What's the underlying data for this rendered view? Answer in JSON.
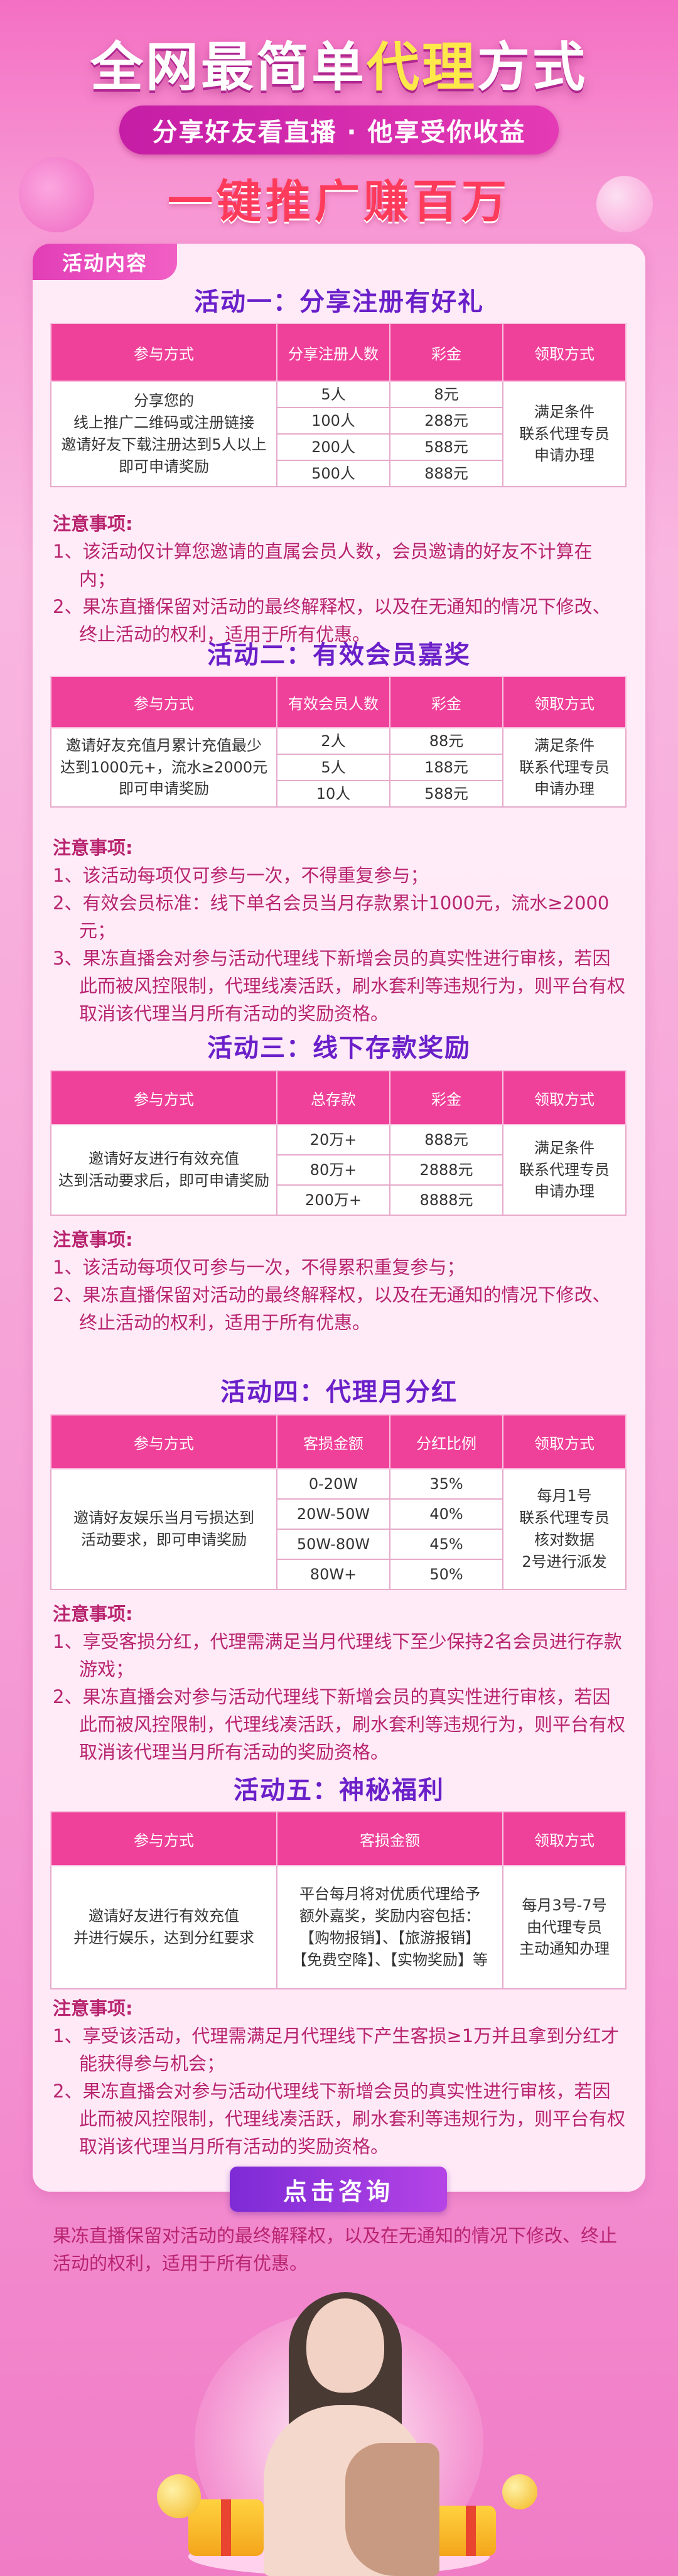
{
  "hero": {
    "title_part1": "全网最简单",
    "title_highlight": "代理",
    "title_part2": "方式",
    "subtitle": "分享好友看直播 · 他享受你收益",
    "slogan": "一键推广赚百万"
  },
  "card_tab": "活动内容",
  "notes_label": "注意事项:",
  "activities": [
    {
      "title": "活动一：分享注册有好礼",
      "headers": [
        "参与方式",
        "分享注册人数",
        "彩金",
        "领取方式"
      ],
      "method": "分享您的\n线上推广二维码或注册链接\n邀请好友下载注册达到5人以上\n即可申请奖励",
      "tiers": [
        [
          "5人",
          "8元"
        ],
        [
          "100人",
          "288元"
        ],
        [
          "200人",
          "588元"
        ],
        [
          "500人",
          "888元"
        ]
      ],
      "claim": "满足条件\n联系代理专员\n申请办理",
      "notes": [
        "1、该活动仅计算您邀请的直属会员人数，会员邀请的好友不计算在内；",
        "2、果冻直播保留对活动的最终解释权，以及在无通知的情况下修改、终止活动的权利，适用于所有优惠。"
      ]
    },
    {
      "title": "活动二：有效会员嘉奖",
      "headers": [
        "参与方式",
        "有效会员人数",
        "彩金",
        "领取方式"
      ],
      "method": "邀请好友充值月累计充值最少\n达到1000元+，流水≥2000元\n即可申请奖励",
      "tiers": [
        [
          "2人",
          "88元"
        ],
        [
          "5人",
          "188元"
        ],
        [
          "10人",
          "588元"
        ]
      ],
      "claim": "满足条件\n联系代理专员\n申请办理",
      "notes": [
        "1、该活动每项仅可参与一次，不得重复参与；",
        "2、有效会员标准：线下单名会员当月存款累计1000元，流水≥2000元；",
        "3、果冻直播会对参与活动代理线下新增会员的真实性进行审核，若因此而被风控限制，代理线凑活跃，刷水套利等违规行为，则平台有权取消该代理当月所有活动的奖励资格。"
      ]
    },
    {
      "title": "活动三：线下存款奖励",
      "headers": [
        "参与方式",
        "总存款",
        "彩金",
        "领取方式"
      ],
      "method": "邀请好友进行有效充值\n达到活动要求后，即可申请奖励",
      "tiers": [
        [
          "20万+",
          "888元"
        ],
        [
          "80万+",
          "2888元"
        ],
        [
          "200万+",
          "8888元"
        ]
      ],
      "claim": "满足条件\n联系代理专员\n申请办理",
      "notes": [
        "1、该活动每项仅可参与一次，不得累积重复参与；",
        "2、果冻直播保留对活动的最终解释权，以及在无通知的情况下修改、终止活动的权利，适用于所有优惠。"
      ]
    },
    {
      "title": "活动四：代理月分红",
      "headers": [
        "参与方式",
        "客损金额",
        "分红比例",
        "领取方式"
      ],
      "method": "邀请好友娱乐当月亏损达到\n活动要求，即可申请奖励",
      "tiers": [
        [
          "0-20W",
          "35%"
        ],
        [
          "20W-50W",
          "40%"
        ],
        [
          "50W-80W",
          "45%"
        ],
        [
          "80W+",
          "50%"
        ]
      ],
      "claim": "每月1号\n联系代理专员\n核对数据\n2号进行派发",
      "notes": [
        "1、享受客损分红，代理需满足当月代理线下至少保持2名会员进行存款游戏；",
        "2、果冻直播会对参与活动代理线下新增会员的真实性进行审核，若因此而被风控限制，代理线凑活跃，刷水套利等违规行为，则平台有权取消该代理当月所有活动的奖励资格。"
      ]
    },
    {
      "title": "活动五：神秘福利",
      "headers": [
        "参与方式",
        "客损金额",
        "领取方式"
      ],
      "method": "邀请好友进行有效充值\n并进行娱乐，达到分红要求",
      "reward": "平台每月将对优质代理给予\n额外嘉奖，奖励内容包括：\n【购物报销】、【旅游报销】\n【免费空降】、【实物奖励】等",
      "claim": "每月3号-7号\n由代理专员\n主动通知办理",
      "notes": [
        "1、享受该活动，代理需满足月代理线下产生客损≥1万并且拿到分红才能获得参与机会；",
        "2、果冻直播会对参与活动代理线下新增会员的真实性进行审核，若因此而被风控限制，代理线凑活跃，刷水套利等违规行为，则平台有权取消该代理当月所有活动的奖励资格。"
      ]
    }
  ],
  "cta_label": "点击咨询",
  "footer_note": "果冻直播保留对活动的最终解释权，以及在无通知的情况下修改、终止活动的权利，适用于所有优惠。",
  "colors": {
    "header_pink": "#f0419a",
    "title_purple": "#6a1fc9",
    "note_red": "#b8246f",
    "cta_purple": "#7d2bd6"
  }
}
